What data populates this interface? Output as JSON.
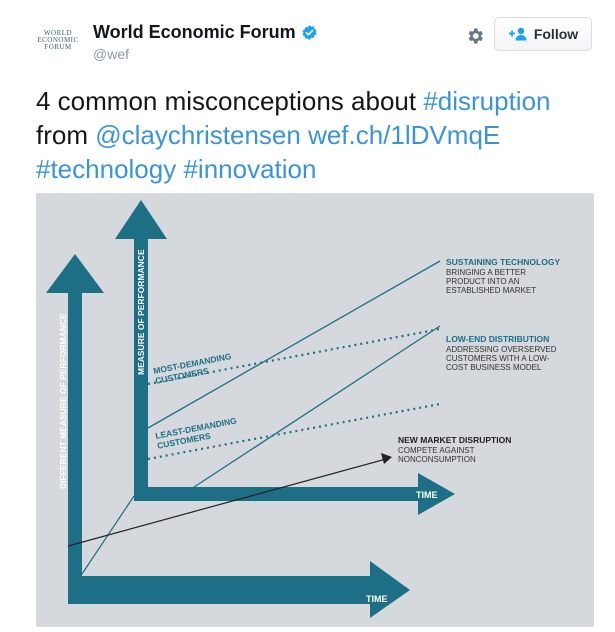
{
  "header": {
    "avatar_text": "WORLD\nECONOMIC\nFORUM",
    "display_name": "World Economic Forum",
    "handle": "@wef",
    "follow_label": "Follow"
  },
  "tweet": {
    "text_1": "4 common misconceptions about ",
    "hashtag_disruption": "#disruption",
    "text_2": "from ",
    "mention": "@claychristensen",
    "link": "wef.ch/1lDVmqE",
    "hashtag_technology": "#technology",
    "hashtag_innovation": "#innovation"
  },
  "diagram": {
    "inner_y_axis_label": "MEASURE OF PERFORMANCE",
    "outer_y_axis_label": "DIFFERENT MEASURE OF PERFORMANCE",
    "inner_x_axis_label": "TIME",
    "outer_x_axis_label": "TIME",
    "most_demanding_line1": "MOST-DEMANDING",
    "most_demanding_line2": "CUSTOMERS",
    "least_demanding_line1": "LEAST-DEMANDING",
    "least_demanding_line2": "CUSTOMERS",
    "sustaining_title": "SUSTAINING TECHNOLOGY",
    "sustaining_desc_1": "BRINGING A BETTER",
    "sustaining_desc_2": "PRODUCT INTO AN",
    "sustaining_desc_3": "ESTABLISHED MARKET",
    "lowend_title": "LOW-END DISTRIBUTION",
    "lowend_desc_1": "ADDRESSING OVERSERVED",
    "lowend_desc_2": "CUSTOMERS WITH A LOW-",
    "lowend_desc_3": "COST BUSINESS MODEL",
    "newmarket_title": "NEW MARKET DISRUPTION",
    "newmarket_desc_1": "COMPETE AGAINST",
    "newmarket_desc_2": "NONCONSUMPTION"
  },
  "colors": {
    "teal": "#1d6f86",
    "blue_link": "#3b94d9",
    "verified": "#1da1f2",
    "media_bg": "#d5d9de"
  }
}
